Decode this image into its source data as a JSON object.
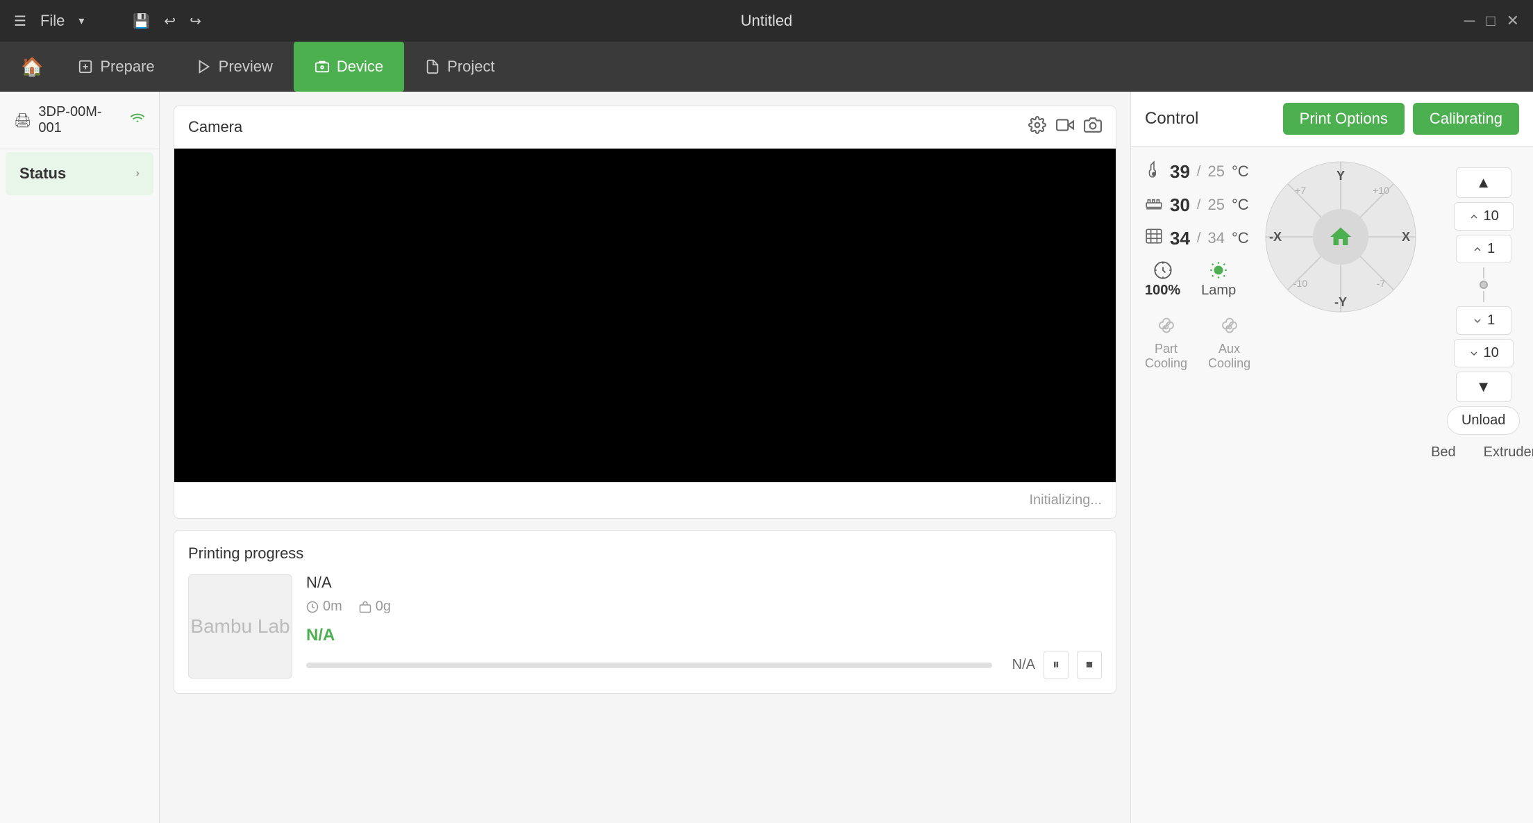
{
  "window": {
    "title": "Untitled"
  },
  "titlebar": {
    "file_label": "File",
    "save_icon": "💾",
    "undo_icon": "↩",
    "redo_icon": "↪"
  },
  "navbar": {
    "tabs": [
      {
        "id": "prepare",
        "label": "Prepare",
        "active": false
      },
      {
        "id": "preview",
        "label": "Preview",
        "active": false
      },
      {
        "id": "device",
        "label": "Device",
        "active": true
      },
      {
        "id": "project",
        "label": "Project",
        "active": false
      }
    ]
  },
  "sidebar": {
    "device_id": "3DP-00M-001",
    "items": [
      {
        "id": "status",
        "label": "Status",
        "active": true
      }
    ]
  },
  "camera": {
    "title": "Camera",
    "status": "Initializing..."
  },
  "printing_progress": {
    "title": "Printing progress",
    "filename": "N/A",
    "time": "0m",
    "weight": "0g",
    "layer": "N/A",
    "progress_pct": "N/A",
    "progress_value": 0
  },
  "control": {
    "title": "Control",
    "print_options_label": "Print Options",
    "calibrating_label": "Calibrating",
    "nozzle_temp": "39",
    "nozzle_target": "25",
    "bed_temp": "30",
    "bed_target": "25",
    "chamber_temp": "34",
    "chamber_target": "34",
    "temp_unit": "°C",
    "speed_pct": "100%",
    "lamp_label": "Lamp",
    "part_cooling_label": "Part Cooling",
    "aux_cooling_label": "Aux Cooling",
    "jog": {
      "y_plus": "+Y",
      "y_minus": "-Y",
      "x_minus": "-X",
      "x_plus": "X",
      "home": "🏠"
    },
    "z_buttons": [
      "10",
      "1",
      "1",
      "10"
    ],
    "bed_label": "Bed",
    "extruder_label": "Extruder",
    "unload_label": "Unload"
  },
  "icons": {
    "hamburger": "☰",
    "chevron_right": "›",
    "wifi": "📶",
    "printer": "🖨",
    "camera_settings": "⚙",
    "camera_record": "🎥",
    "camera_snapshot": "📷",
    "time_icon": "🕐",
    "weight_icon": "⚖",
    "pause_icon": "⏸",
    "stop_icon": "⏹",
    "close": "✕",
    "minimize": "─",
    "maximize": "□",
    "bambu_logo": "Bambu Lab"
  }
}
